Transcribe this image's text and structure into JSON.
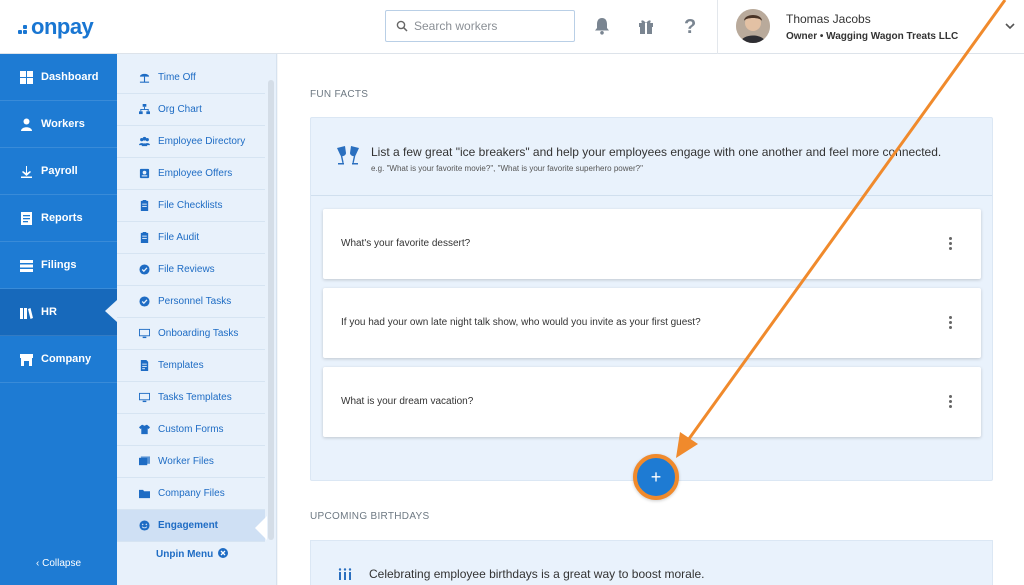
{
  "header": {
    "logo": "onpay",
    "search_placeholder": "Search workers",
    "user_name": "Thomas Jacobs",
    "user_role": "Owner • Wagging Wagon Treats LLC"
  },
  "nav": {
    "items": [
      {
        "label": "Dashboard",
        "icon": "dashboard-icon"
      },
      {
        "label": "Workers",
        "icon": "workers-icon"
      },
      {
        "label": "Payroll",
        "icon": "payroll-icon"
      },
      {
        "label": "Reports",
        "icon": "reports-icon"
      },
      {
        "label": "Filings",
        "icon": "filings-icon"
      },
      {
        "label": "HR",
        "icon": "hr-icon"
      },
      {
        "label": "Company",
        "icon": "company-icon"
      }
    ],
    "collapse_label": "‹ Collapse"
  },
  "subnav": {
    "items": [
      {
        "label": "Time Off"
      },
      {
        "label": "Org Chart"
      },
      {
        "label": "Employee Directory"
      },
      {
        "label": "Employee Offers"
      },
      {
        "label": "File Checklists"
      },
      {
        "label": "File Audit"
      },
      {
        "label": "File Reviews"
      },
      {
        "label": "Personnel Tasks"
      },
      {
        "label": "Onboarding Tasks"
      },
      {
        "label": "Templates"
      },
      {
        "label": "Tasks Templates"
      },
      {
        "label": "Custom Forms"
      },
      {
        "label": "Worker Files"
      },
      {
        "label": "Company Files"
      },
      {
        "label": "Engagement"
      }
    ],
    "unpin_label": "Unpin Menu"
  },
  "main": {
    "fun_facts_title": "FUN FACTS",
    "intro": "List a few great \"ice breakers\" and help your employees engage with one another and feel more connected.",
    "example": "e.g. \"What is your favorite movie?\", \"What is your favorite superhero power?\"",
    "questions": [
      "What's your favorite dessert?",
      "If you had your own late night talk show, who would you invite as your first guest?",
      "What is your dream vacation?"
    ],
    "add_label": "+",
    "birthdays_title": "UPCOMING BIRTHDAYS",
    "birthdays_intro": "Celebrating employee birthdays is a great way to boost morale."
  },
  "colors": {
    "brand_blue": "#1e7bd3",
    "annotation_orange": "#f08a2c"
  }
}
